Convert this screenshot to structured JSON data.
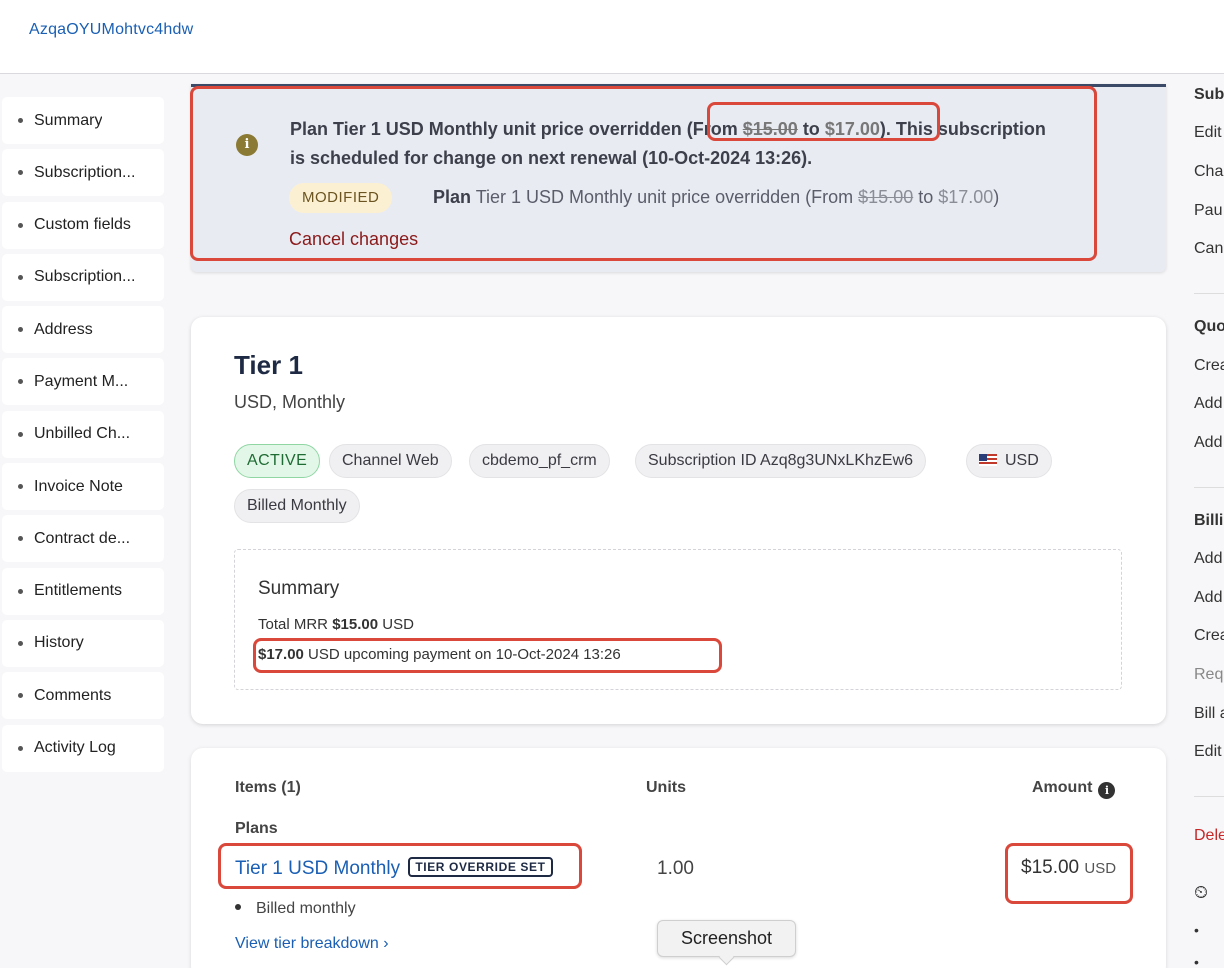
{
  "header": {
    "title": "AzqaOYUMohtvc4hdw"
  },
  "sidebar": {
    "items": [
      {
        "label": "Summary"
      },
      {
        "label": "Subscription..."
      },
      {
        "label": "Custom fields"
      },
      {
        "label": "Subscription..."
      },
      {
        "label": "Address"
      },
      {
        "label": "Payment M..."
      },
      {
        "label": "Unbilled Ch..."
      },
      {
        "label": "Invoice Note"
      },
      {
        "label": "Contract de..."
      },
      {
        "label": "Entitlements"
      },
      {
        "label": "History"
      },
      {
        "label": "Comments"
      },
      {
        "label": "Activity Log"
      }
    ]
  },
  "banner": {
    "msg_prefix": "Plan Tier 1 USD Monthly unit price overridden ",
    "msg_from": "(From ",
    "msg_old_price": "$15.00",
    "msg_to": " to ",
    "msg_new_price": "$17.00",
    "msg_close": ")",
    "msg_suffix": ". This subscription is scheduled for change on next renewal (10-Oct-2024 13:26).",
    "badge": "MODIFIED",
    "mod_plan": "Plan",
    "mod_text": " Tier 1 USD Monthly unit price overridden (From ",
    "mod_old": "$15.00",
    "mod_to": " to ",
    "mod_new": "$17.00",
    "mod_close": ")",
    "cancel": "Cancel changes"
  },
  "plan_card": {
    "title": "Tier 1",
    "subtitle": "USD, Monthly",
    "chips": {
      "status": "ACTIVE",
      "channel": "Channel Web",
      "crm": "cbdemo_pf_crm",
      "sub_id": "Subscription ID Azq8g3UNxLKhzEw6",
      "currency": "USD",
      "billing": "Billed Monthly"
    },
    "summary": {
      "title": "Summary",
      "mrr_label": "Total MRR ",
      "mrr_value": "$15.00",
      "mrr_currency": " USD",
      "upcoming_amount": "$17.00",
      "upcoming_text": " USD upcoming payment on 10-Oct-2024 13:26"
    }
  },
  "items": {
    "header_items": "Items (1)",
    "header_units": "Units",
    "header_amount": "Amount",
    "plans_label": "Plans",
    "plan_name": "Tier 1 USD Monthly",
    "override_badge": "TIER OVERRIDE SET",
    "units": "1.00",
    "amount": "$15.00",
    "amount_currency": "USD",
    "billed": "Billed monthly",
    "tier_link": "View tier breakdown ›"
  },
  "tooltip": "Screenshot",
  "right_panel": {
    "head1": "Sub",
    "a1": "Edit",
    "a2": "Cha",
    "a3": "Pau",
    "a4": "Can",
    "head2": "Quo",
    "b1": "Crea",
    "b2": "Add",
    "b3": "Add",
    "head3": "Billi",
    "c1": "Add",
    "c2": "Add",
    "c3": "Crea",
    "c4": "Req",
    "c5": "Bill a",
    "c6": "Edit",
    "d1": "Dele"
  },
  "colors": {
    "accent": "#1a5fb4",
    "highlight_box": "#d9483b",
    "danger": "#8b1a1a",
    "active_chip": "#e3f7e8"
  }
}
